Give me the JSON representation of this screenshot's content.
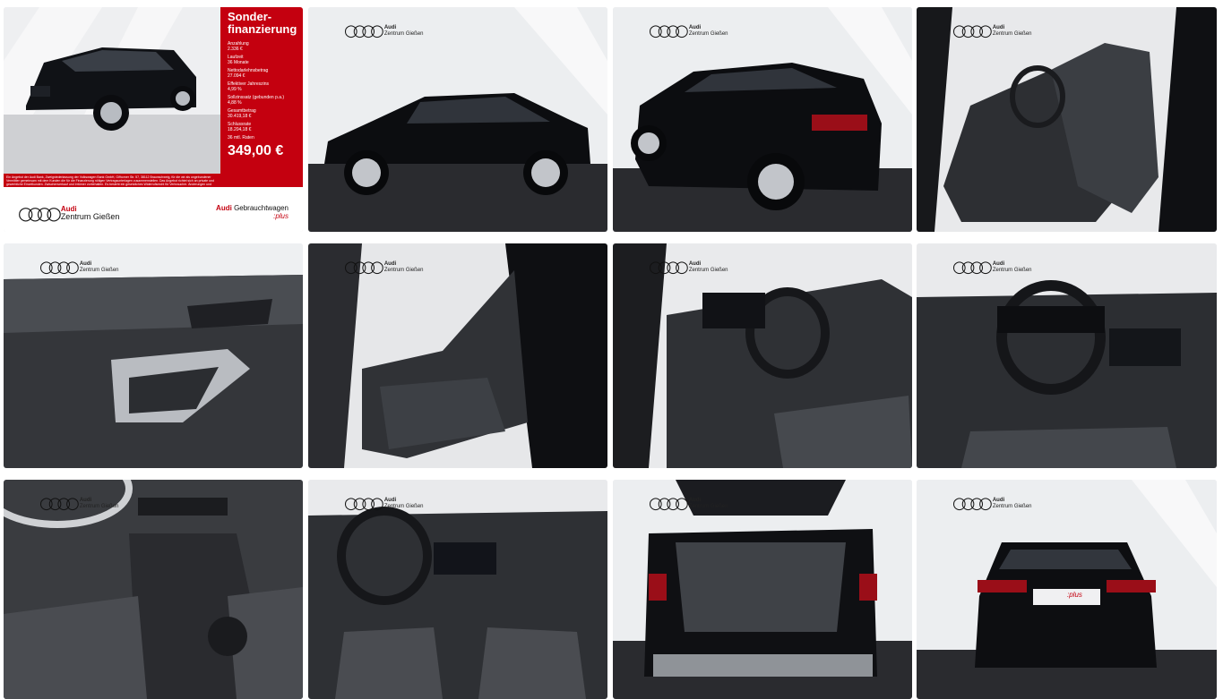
{
  "promo": {
    "title": "Sonder-\nfinanzierung",
    "rows": [
      {
        "label": "Anzahlung",
        "value": "2.336 €"
      },
      {
        "label": "Laufzeit",
        "value": "36 Monate"
      },
      {
        "label": "Nettodarlehnsbetrag",
        "value": "27.094 €"
      },
      {
        "label": "Effektiver Jahreszins",
        "value": "4,99 %"
      },
      {
        "label": "Sollzinssatz (gebunden p.a.)",
        "value": "4,88 %"
      },
      {
        "label": "Gesamtbetrag",
        "value": "30.419,18 €"
      },
      {
        "label": "Schlussrate",
        "value": "18.204,18 €"
      }
    ],
    "rate_label": "36 mtl. Raten",
    "price": "349,00 €",
    "disclaimer": "Ein Angebot der Audi Bank, Zweigniederlassung der Volkswagen Bank GmbH, Gifhorner Str. 57, 38112 Braunschweig, für die wir als ungebundener Vermittler gemeinsam mit dem Kunden die für die Finanzierung nötigen Vertragsunterlagen zusammenstellen. Das Angebot richtet sich an private und gewerbliche Einzelkunden. Zwischenverkauf und Irrtümer vorbehalten. Es besteht ein gesetzliches Widerrufsrecht für Verbraucher. Änderungen und Irrtümer vorbehalten.",
    "footer_brand": "Audi",
    "footer_dealer": "Zentrum Gießen",
    "footer_right_brand": "Audi",
    "footer_right_text": "Gebrauchtwagen",
    "footer_right_plus": ":plus"
  },
  "dealer": {
    "brand": "Audi",
    "name": "Zentrum Gießen"
  },
  "rings_glyph": "○○○○",
  "tiles": [
    {
      "name": "photo-1-financing-offer"
    },
    {
      "name": "photo-2-side-view"
    },
    {
      "name": "photo-3-rear-three-quarter"
    },
    {
      "name": "photo-4-front-seats"
    },
    {
      "name": "photo-5-door-panel"
    },
    {
      "name": "photo-6-rear-seats"
    },
    {
      "name": "photo-7-cockpit-side"
    },
    {
      "name": "photo-8-dashboard"
    },
    {
      "name": "photo-9-center-console"
    },
    {
      "name": "photo-10-full-dashboard"
    },
    {
      "name": "photo-11-trunk-open"
    },
    {
      "name": "photo-12-rear-view"
    }
  ],
  "plate_text": ":plus"
}
